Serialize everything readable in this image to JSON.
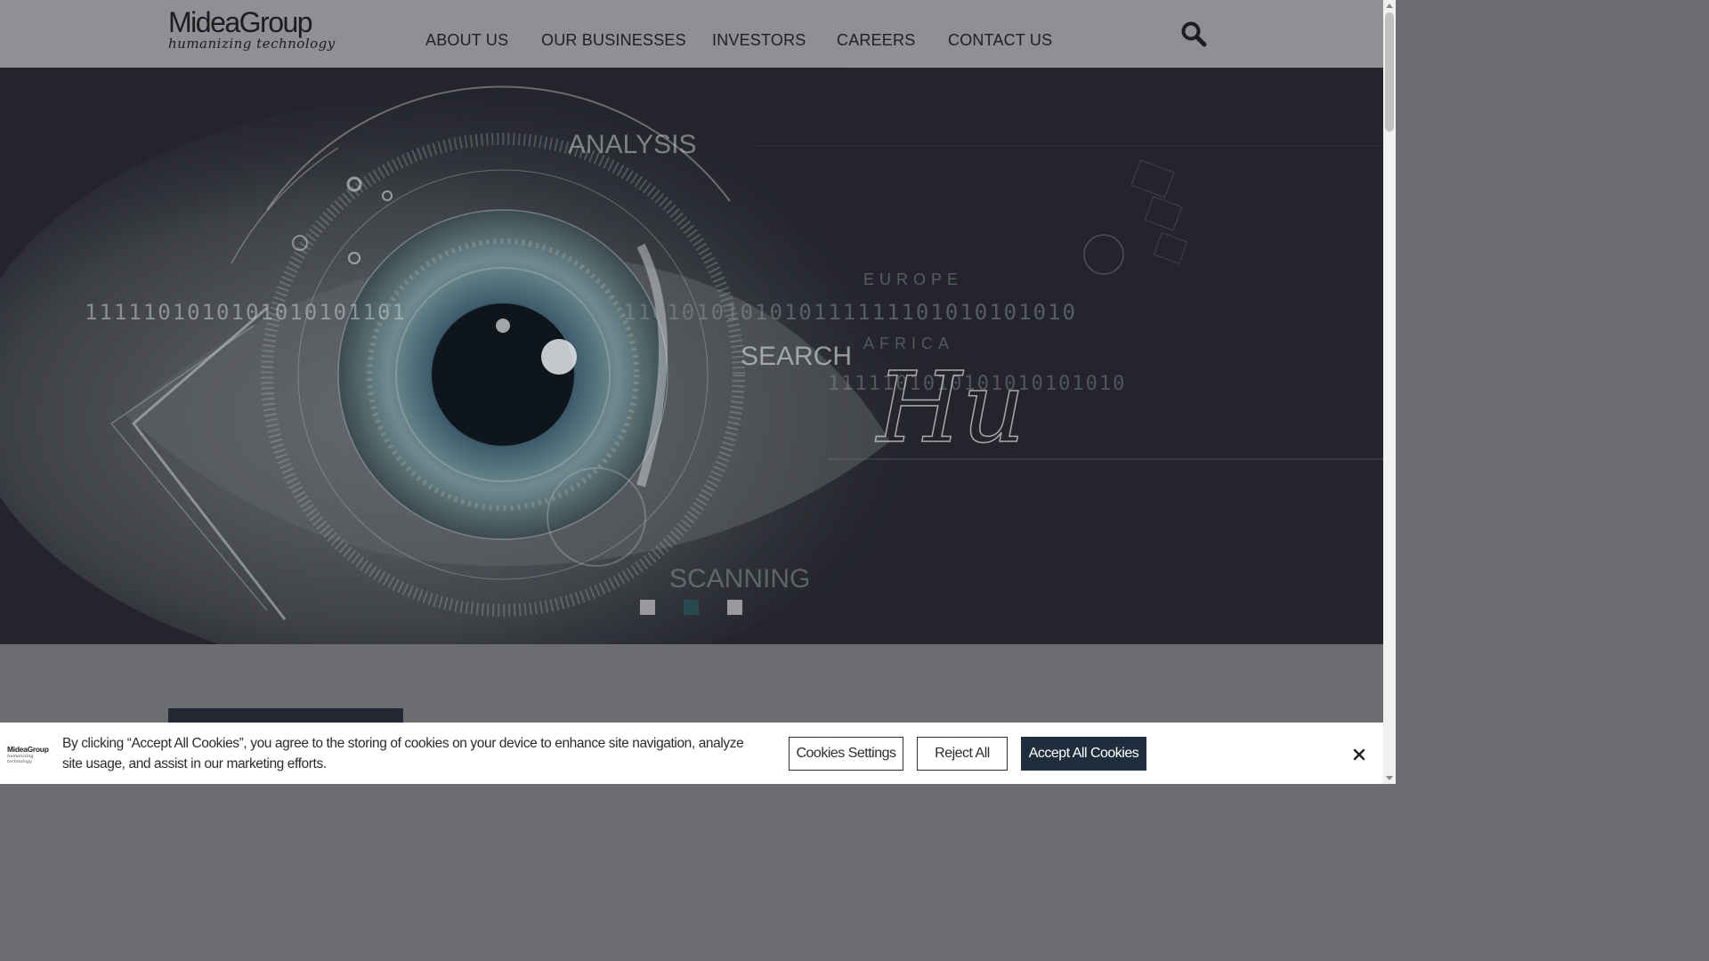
{
  "header": {
    "logo_name": "MideaGroup",
    "logo_tagline": "humanizing technology",
    "nav": [
      {
        "label": "ABOUT US"
      },
      {
        "label": "OUR BUSINESSES"
      },
      {
        "label": "INVESTORS"
      },
      {
        "label": "CAREERS"
      },
      {
        "label": "CONTACT US"
      }
    ],
    "search_icon": "search-icon"
  },
  "hero": {
    "image": "digital-eye-illustration",
    "overlay_words": {
      "analysis": "ANALYSIS",
      "search": "SEARCH",
      "scanning": "SCANNING",
      "europe": "EUROPE",
      "africa": "AFRICA",
      "binary_1": "1111101010101010101101",
      "binary_2": "1101010101010111111101010101010",
      "binary_3": "1111101010101010101010",
      "script_word": "Hu"
    },
    "carousel": {
      "slide_count": 3,
      "active_index": 1
    }
  },
  "cookie_banner": {
    "logo_name": "MideaGroup",
    "logo_tagline": "humanizing technology",
    "text": "By clicking “Accept All Cookies”, you agree to the storing of cookies on your device to enhance site navigation, analyze site usage, and assist in our marketing efforts.",
    "settings_label": "Cookies Settings",
    "reject_label": "Reject All",
    "accept_label": "Accept All Cookies",
    "close_icon": "close-icon"
  },
  "colors": {
    "header_bg": "#8e9093",
    "accept_button": "#1f2d3d",
    "active_dot": "#274a50",
    "page_bg": "#6b6d70"
  }
}
